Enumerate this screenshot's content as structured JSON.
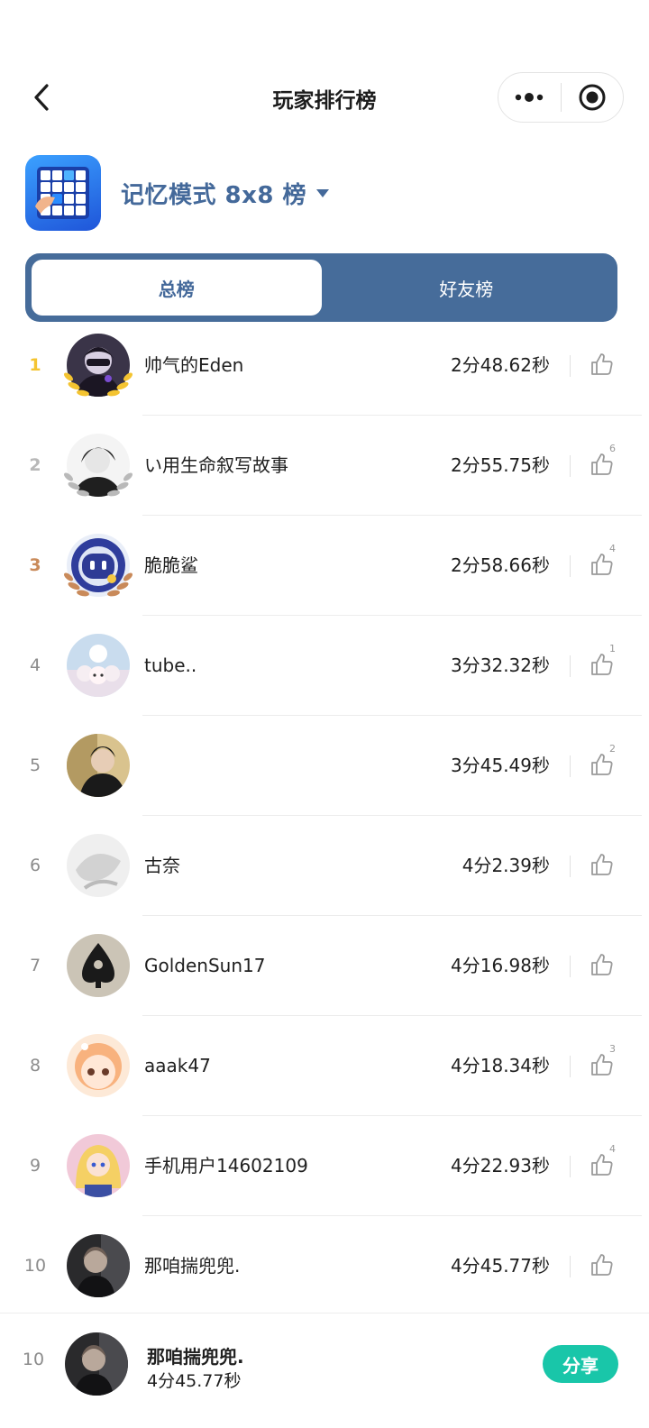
{
  "header": {
    "title": "玩家排行榜"
  },
  "game": {
    "mode_label": "记忆模式 8x8 榜"
  },
  "tabs": [
    {
      "label": "总榜",
      "active": true
    },
    {
      "label": "好友榜",
      "active": false
    }
  ],
  "leaderboard": [
    {
      "rank": "1",
      "name": "帅气的Eden",
      "time": "2分48.62秒",
      "likes": "",
      "medal": "gold"
    },
    {
      "rank": "2",
      "name": "い用生命叙写故事",
      "time": "2分55.75秒",
      "likes": "6",
      "medal": "silver"
    },
    {
      "rank": "3",
      "name": "脆脆鲨",
      "time": "2分58.66秒",
      "likes": "4",
      "medal": "bronze"
    },
    {
      "rank": "4",
      "name": "tube..",
      "time": "3分32.32秒",
      "likes": "1",
      "medal": ""
    },
    {
      "rank": "5",
      "name": "",
      "time": "3分45.49秒",
      "likes": "2",
      "medal": ""
    },
    {
      "rank": "6",
      "name": "古奈",
      "time": "4分2.39秒",
      "likes": "",
      "medal": ""
    },
    {
      "rank": "7",
      "name": "GoldenSun17",
      "time": "4分16.98秒",
      "likes": "",
      "medal": ""
    },
    {
      "rank": "8",
      "name": "aaak47",
      "time": "4分18.34秒",
      "likes": "3",
      "medal": ""
    },
    {
      "rank": "9",
      "name": "手机用户14602109",
      "time": "4分22.93秒",
      "likes": "4",
      "medal": ""
    },
    {
      "rank": "10",
      "name": "那咱揣兜兜.",
      "time": "4分45.77秒",
      "likes": "",
      "medal": ""
    }
  ],
  "me": {
    "rank": "10",
    "name": "那咱揣兜兜.",
    "time": "4分45.77秒",
    "share_label": "分享"
  },
  "colors": {
    "accent": "#466c9a",
    "share": "#19c6a9",
    "gold": "#f4c431",
    "silver": "#b8b8b8",
    "bronze": "#c98a5a"
  }
}
